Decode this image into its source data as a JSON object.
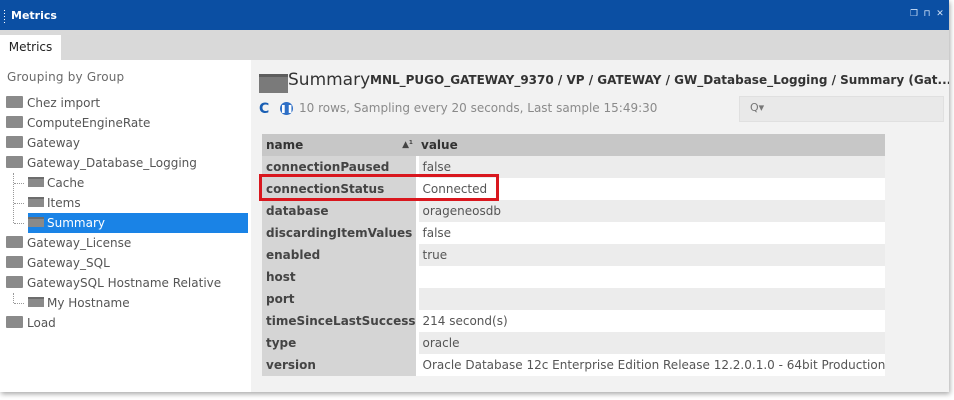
{
  "window": {
    "title": "Metrics"
  },
  "tabs": [
    {
      "label": "Metrics"
    }
  ],
  "sidebar": {
    "title": "Grouping by Group",
    "items": [
      {
        "label": "Chez import"
      },
      {
        "label": "ComputeEngineRate"
      },
      {
        "label": "Gateway"
      },
      {
        "label": "Gateway_Database_Logging"
      },
      {
        "label": "Cache"
      },
      {
        "label": "Items"
      },
      {
        "label": "Summary"
      },
      {
        "label": "Gateway_License"
      },
      {
        "label": "Gateway_SQL"
      },
      {
        "label": "GatewaySQL Hostname Relative"
      },
      {
        "label": "My Hostname"
      },
      {
        "label": "Load"
      }
    ],
    "selected": "Summary"
  },
  "main": {
    "title": "Summary",
    "path": "MNL_PUGO_GATEWAY_9370 / VP / GATEWAY / GW_Database_Logging / Summary (Gat...",
    "status": "10 rows, Sampling every 20 seconds, Last sample 15:49:30",
    "search_placeholder": "",
    "table": {
      "headers": {
        "name": "name",
        "value": "value",
        "sort_indicator": "▲¹"
      },
      "rows": [
        {
          "name": "connectionPaused",
          "value": "false"
        },
        {
          "name": "connectionStatus",
          "value": "Connected"
        },
        {
          "name": "database",
          "value": "orageneosdb"
        },
        {
          "name": "discardingItemValues",
          "value": "false"
        },
        {
          "name": "enabled",
          "value": "true"
        },
        {
          "name": "host",
          "value": ""
        },
        {
          "name": "port",
          "value": ""
        },
        {
          "name": "timeSinceLastSuccess",
          "value": "214 second(s)"
        },
        {
          "name": "type",
          "value": "oracle"
        },
        {
          "name": "version",
          "value": "Oracle Database 12c Enterprise Edition Release 12.2.0.1.0 - 64bit Production"
        }
      ]
    }
  },
  "annotation": {
    "color": "#d9171e"
  },
  "colors": {
    "titlebar": "#0b4fa3",
    "selection": "#1a83e6"
  },
  "icons": {
    "refresh": "refresh-icon",
    "pause": "pause-icon",
    "search": "search-icon",
    "folder": "folder-icon",
    "metric": "metric-icon"
  }
}
